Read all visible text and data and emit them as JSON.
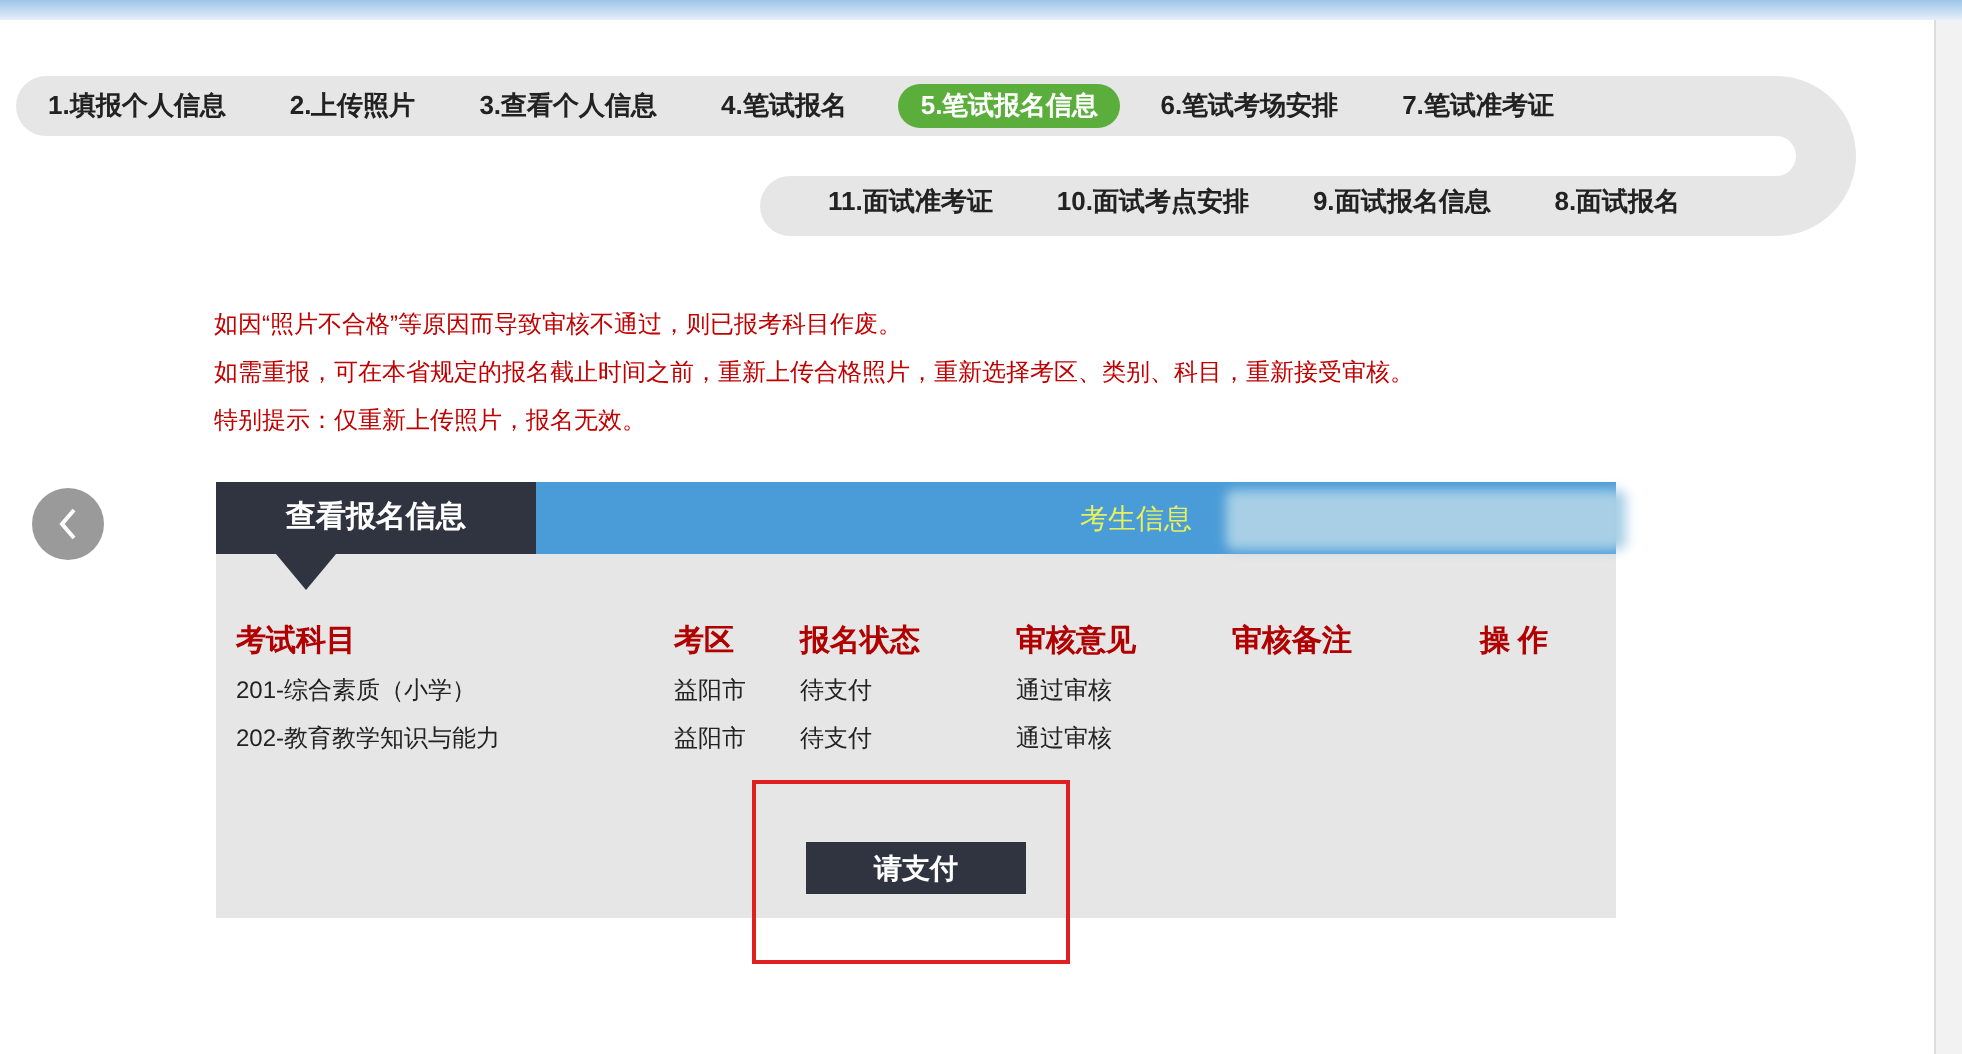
{
  "steps_top": [
    {
      "label": "1.填报个人信息",
      "selected": false
    },
    {
      "label": "2.上传照片",
      "selected": false
    },
    {
      "label": "3.查看个人信息",
      "selected": false
    },
    {
      "label": "4.笔试报名",
      "selected": false
    },
    {
      "label": "5.笔试报名信息",
      "selected": true
    },
    {
      "label": "6.笔试考场安排",
      "selected": false
    },
    {
      "label": "7.笔试准考证",
      "selected": false
    }
  ],
  "steps_bottom": [
    {
      "label": "11.面试准考证",
      "selected": false
    },
    {
      "label": "10.面试考点安排",
      "selected": false
    },
    {
      "label": "9.面试报名信息",
      "selected": false
    },
    {
      "label": "8.面试报名",
      "selected": false
    }
  ],
  "notices": [
    "如因“照片不合格”等原因而导致审核不通过，则已报考科目作废。",
    "如需重报，可在本省规定的报名截止时间之前，重新上传合格照片，重新选择考区、类别、科目，重新接受审核。",
    "特别提示：仅重新上传照片，报名无效。"
  ],
  "panel": {
    "tab": "查看报名信息",
    "candidate_label": "考生信息",
    "table": {
      "columns": [
        "考试科目",
        "考区",
        "报名状态",
        "审核意见",
        "审核备注",
        "操 作"
      ],
      "rows": [
        [
          "201-综合素质（小学）",
          "益阳市",
          "待支付",
          "通过审核"
        ],
        [
          "202-教育教学知识与能力",
          "益阳市",
          "待支付",
          "通过审核"
        ]
      ]
    },
    "pay_button": "请支付"
  }
}
